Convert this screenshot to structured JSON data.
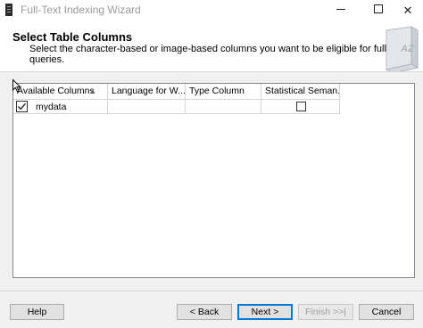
{
  "window": {
    "title": "Full-Text Indexing Wizard",
    "minimize_glyph": "",
    "close_glyph": "✕"
  },
  "header": {
    "title": "Select Table Columns",
    "subtitle": "Select the character-based or image-based columns you want to be eligible for full-text queries."
  },
  "grid": {
    "columns": [
      "Available Columns",
      "Language for W...",
      "Type Column",
      "Statistical Seman..."
    ],
    "sort_indicator": "▲",
    "rows": [
      {
        "checked": true,
        "name": "mydata",
        "language": "",
        "type_column": "",
        "statistical_semantics": false
      }
    ]
  },
  "buttons": {
    "help": "Help",
    "back": "< Back",
    "next": "Next >",
    "finish": "Finish >>|",
    "cancel": "Cancel"
  },
  "colors": {
    "title_text": "#9b9b9b",
    "content_bg": "#f0f0f0",
    "default_button_border": "#0078d7"
  },
  "icons": {
    "app": "wizard-app-icon",
    "header": "book-az-icon"
  }
}
